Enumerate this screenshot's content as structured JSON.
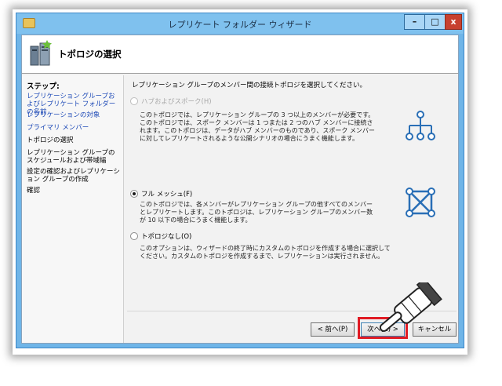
{
  "window": {
    "title": "レプリケート フォルダー ウィザード",
    "min_label": "–",
    "max_label": "□",
    "close_label": "x"
  },
  "header": {
    "title": "トポロジの選択"
  },
  "sidebar": {
    "title": "ステップ:",
    "steps": [
      {
        "label": "レプリケーション グループおよびレプリケート フォルダーの名前",
        "state": "link"
      },
      {
        "label": "レプリケーションの対象",
        "state": "link"
      },
      {
        "label": "プライマリ メンバー",
        "state": "link"
      },
      {
        "label": "トポロジの選択",
        "state": "current"
      },
      {
        "label": "レプリケーション グループのスケジュールおよび帯域幅",
        "state": "plain"
      },
      {
        "label": "設定の確認およびレプリケーション グループの作成",
        "state": "plain"
      },
      {
        "label": "確認",
        "state": "plain"
      }
    ]
  },
  "main": {
    "intro": "レプリケーション グループのメンバー間の接続トポロジを選択してください。",
    "options": [
      {
        "label": "ハブおよびスポーク(H)",
        "enabled": false,
        "selected": false,
        "description": "このトポロジでは、レプリケーション グループの 3 つ以上のメンバーが必要です。このトポロジでは、スポーク メンバーは 1 つまたは 2 つのハブ メンバーに接続されます。このトポロジは、データがハブ メンバーのものであり、スポーク メンバーに対してレプリケートされるような公開シナリオの場合にうまく機能します。",
        "icon": "hub-spoke-icon"
      },
      {
        "label": "フル メッシュ(F)",
        "enabled": true,
        "selected": true,
        "description": "このトポロジでは、各メンバーがレプリケーション グループの他すべてのメンバーとレプリケートします。このトポロジは、レプリケーション グループのメンバー数が 10 以下の場合にうまく機能します。",
        "icon": "full-mesh-icon"
      },
      {
        "label": "トポロジなし(O)",
        "enabled": true,
        "selected": false,
        "description": "このオプションは、ウィザードの終了時にカスタムのトポロジを作成する場合に選択してください。カスタムのトポロジを作成するまで、レプリケーションは実行されません。",
        "icon": ""
      }
    ]
  },
  "footer": {
    "back_label": "< 前へ(P)",
    "next_label": "次へ(N) >",
    "cancel_label": "キャンセル"
  },
  "colors": {
    "accent_blue": "#1a47b6",
    "highlight_red": "#e01b24",
    "icon_blue": "#2a6fb6"
  }
}
